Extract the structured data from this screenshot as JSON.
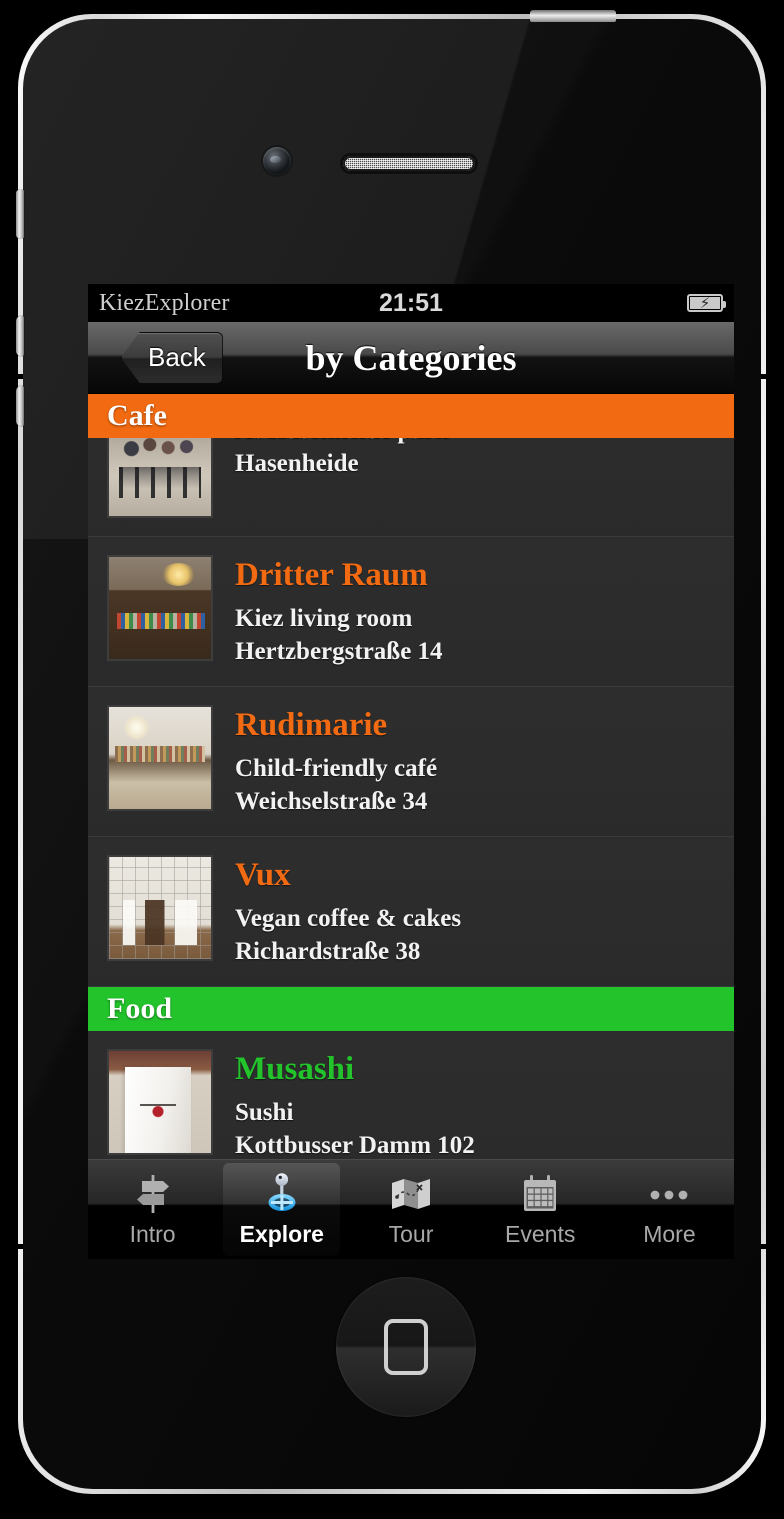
{
  "device": {
    "name": "iphone-4-white-mockup"
  },
  "status_bar": {
    "app_name": "KiezExplorer",
    "clock": "21:51",
    "battery_icon": "battery-charging-icon",
    "battery_bolt": "⚡"
  },
  "nav_bar": {
    "back_label": "Back",
    "title": "by Categories"
  },
  "colors": {
    "cafe_header": "#F26A11",
    "food_header": "#22C32B",
    "cafe_title": "#F26A11",
    "food_title": "#22C32B"
  },
  "list": {
    "sections": [
      {
        "label": "Cafe",
        "header_color": "#F26A11",
        "title_color": "#F26A11",
        "rows": [
          {
            "title": "",
            "sub1": "At Hasenheide park",
            "sub2": "Hasenheide",
            "thumb": "cafe-terrace-photo",
            "clipped": true
          },
          {
            "title": "Dritter Raum",
            "sub1": "Kiez living room",
            "sub2": "Hertzbergstraße 14",
            "thumb": "bar-bookshelf-photo"
          },
          {
            "title": "Rudimarie",
            "sub1": "Child-friendly café",
            "sub2": "Weichselstraße 34",
            "thumb": "shop-interior-photo"
          },
          {
            "title": "Vux",
            "sub1": "Vegan coffee & cakes",
            "sub2": "Richardstraße 38",
            "thumb": "white-chairs-photo"
          }
        ]
      },
      {
        "label": "Food",
        "header_color": "#22C32B",
        "title_color": "#22C32B",
        "rows": [
          {
            "title": "Musashi",
            "sub1": "Sushi",
            "sub2": "Kottbusser Damm 102",
            "thumb": "musashi-apron-photo"
          }
        ]
      }
    ]
  },
  "tab_bar": {
    "selected_index": 1,
    "items": [
      {
        "label": "Intro",
        "icon": "signpost-icon"
      },
      {
        "label": "Explore",
        "icon": "map-pin-compass-icon"
      },
      {
        "label": "Tour",
        "icon": "folded-map-icon"
      },
      {
        "label": "Events",
        "icon": "calendar-icon"
      },
      {
        "label": "More",
        "icon": "ellipsis-icon"
      }
    ]
  }
}
